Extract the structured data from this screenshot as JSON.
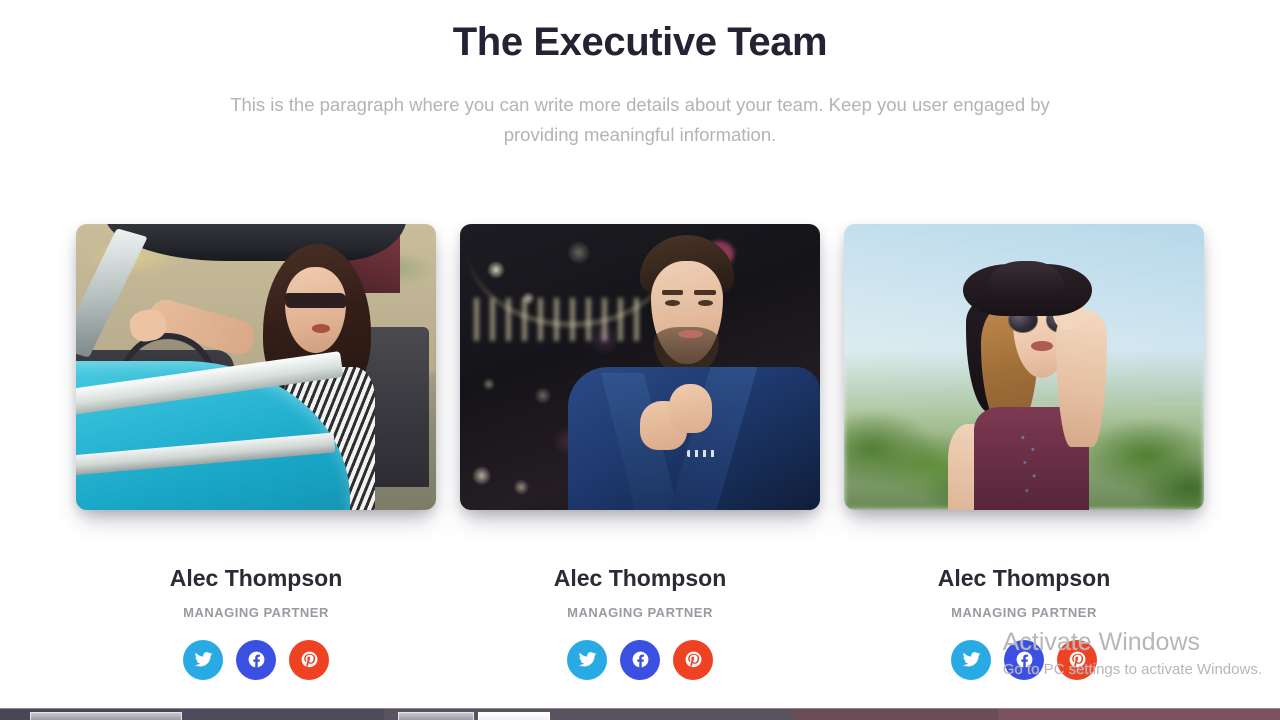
{
  "header": {
    "title": "The Executive Team",
    "subtitle": "This is the paragraph where you can write more details about your team. Keep you user engaged by providing meaningful information."
  },
  "colors": {
    "background": "#ffffff",
    "title": "#232333",
    "subtitle": "#b3b3b8",
    "name": "#2b2b36",
    "role": "#9a9aa2",
    "twitter": "#2aaae4",
    "facebook": "#3b4fe0",
    "pinterest": "#ef4223"
  },
  "team": {
    "members": [
      {
        "name": "Alec Thompson",
        "role": "MANAGING PARTNER",
        "photo_alt": "Woman in sunglasses driving a turquoise classic convertible car",
        "socials": [
          {
            "icon": "twitter-icon",
            "label": "Twitter"
          },
          {
            "icon": "facebook-icon",
            "label": "Facebook"
          },
          {
            "icon": "pinterest-icon",
            "label": "Pinterest"
          }
        ]
      },
      {
        "name": "Alec Thompson",
        "role": "MANAGING PARTNER",
        "photo_alt": "Man in navy blue suit adjusting his collar at night with city bokeh lights",
        "socials": [
          {
            "icon": "twitter-icon",
            "label": "Twitter"
          },
          {
            "icon": "facebook-icon",
            "label": "Facebook"
          },
          {
            "icon": "pinterest-icon",
            "label": "Pinterest"
          }
        ]
      },
      {
        "name": "Alec Thompson",
        "role": "MANAGING PARTNER",
        "photo_alt": "Woman with black wide-brim hat and round sunglasses outdoors under blue sky",
        "socials": [
          {
            "icon": "twitter-icon",
            "label": "Twitter"
          },
          {
            "icon": "facebook-icon",
            "label": "Facebook"
          },
          {
            "icon": "pinterest-icon",
            "label": "Pinterest"
          }
        ]
      }
    ]
  },
  "watermark": {
    "title": "Activate Windows",
    "subtitle": "Go to PC settings to activate Windows."
  }
}
